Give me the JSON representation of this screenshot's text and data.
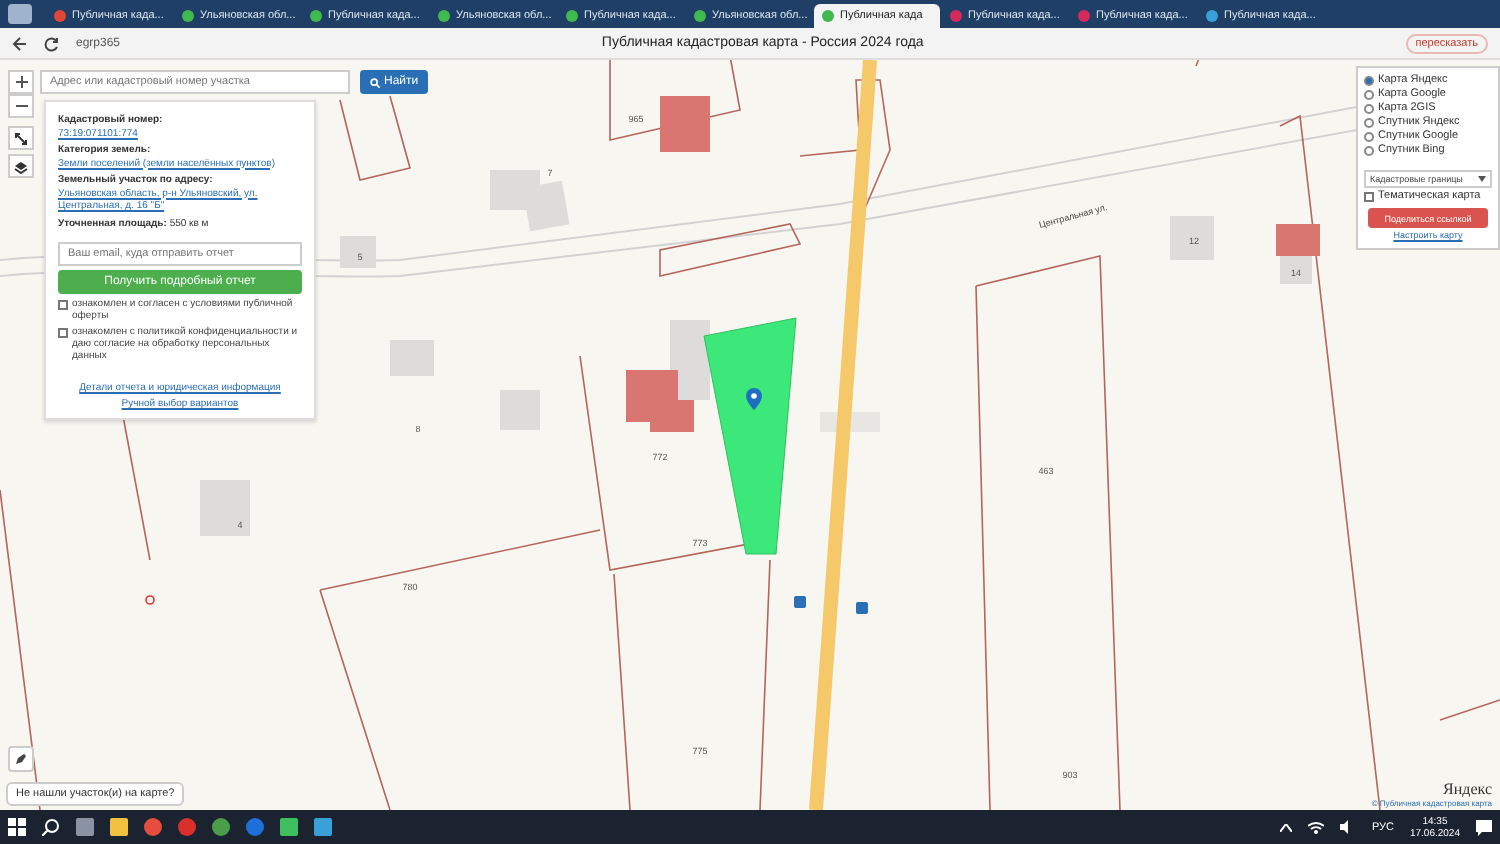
{
  "browser": {
    "tabs": [
      {
        "title": "Публичная када...",
        "kind": "red",
        "selected": false
      },
      {
        "title": "Ульяновская обл...",
        "kind": "check",
        "selected": false
      },
      {
        "title": "Публичная када...",
        "kind": "check",
        "selected": false
      },
      {
        "title": "Ульяновская обл...",
        "kind": "check",
        "selected": false
      },
      {
        "title": "Публичная када...",
        "kind": "check",
        "selected": false
      },
      {
        "title": "Ульяновская обл...",
        "kind": "check",
        "selected": false
      },
      {
        "title": "Публичная када",
        "kind": "check",
        "selected": true
      },
      {
        "title": "Публичная када...",
        "kind": "flag",
        "selected": false
      },
      {
        "title": "Публичная када...",
        "kind": "flag",
        "selected": false
      },
      {
        "title": "Публичная када...",
        "kind": "gem",
        "selected": false
      }
    ],
    "url": "egrp365",
    "page_title": "Публичная кадастровая карта - Россия 2024 года",
    "retell": "пересказать"
  },
  "search": {
    "placeholder": "Адрес или кадастровый номер участка",
    "button": "Найти"
  },
  "info_card": {
    "fields": [
      {
        "label": "Кадастровый номер:",
        "value": "73:19:071101:774",
        "kind": "link"
      },
      {
        "label": "Категория земель:",
        "value": "Земли поселений (земли населённых пунктов)",
        "kind": "link"
      },
      {
        "label": "Земельный участок по адресу:",
        "value": "Ульяновская область, р-н Ульяновский, ул. Центральная, д. 16 \"Б\"",
        "kind": "link"
      },
      {
        "label": "Уточненная площадь:",
        "value": "550 кв м",
        "kind": "plain"
      }
    ],
    "email_placeholder": "Ваш email, куда отправить отчет",
    "button": "Получить подробный отчет",
    "consents": [
      {
        "text": "ознакомлен и согласен с условиями публичной оферты",
        "checked": false
      },
      {
        "text": "ознакомлен с политикой конфиденциальности и даю согласие на обработку персональных данных",
        "checked": false
      }
    ],
    "links": [
      "Детали отчета и юридическая информация",
      "Ручной выбор вариантов"
    ]
  },
  "layers": {
    "options": [
      {
        "label": "Карта Яндекс",
        "selected": true
      },
      {
        "label": "Карта Google",
        "selected": false
      },
      {
        "label": "Карта 2GIS",
        "selected": false
      },
      {
        "label": "Спутник Яндекс",
        "selected": false
      },
      {
        "label": "Спутник Google",
        "selected": false
      },
      {
        "label": "Спутник Bing",
        "selected": false
      }
    ],
    "overlay": "Кадастровые границы",
    "thematic": {
      "label": "Тематическая карта",
      "checked": false
    },
    "share": "Поделиться ссылкой",
    "configure": "Настроить карту"
  },
  "map": {
    "street": "Центральная ул.",
    "plot_labels": [
      "965",
      "7",
      "5",
      "8",
      "4",
      "772",
      "773",
      "463",
      "12",
      "14",
      "775",
      "903",
      "780"
    ]
  },
  "not_found": "Не нашли участок(и) на карте?",
  "attribution": {
    "logo": "Яндекс",
    "credit": "© Публичная кадастровая карта"
  },
  "taskbar": {
    "lang": "РУС",
    "time": "14:35",
    "date": "17.06.2024"
  }
}
